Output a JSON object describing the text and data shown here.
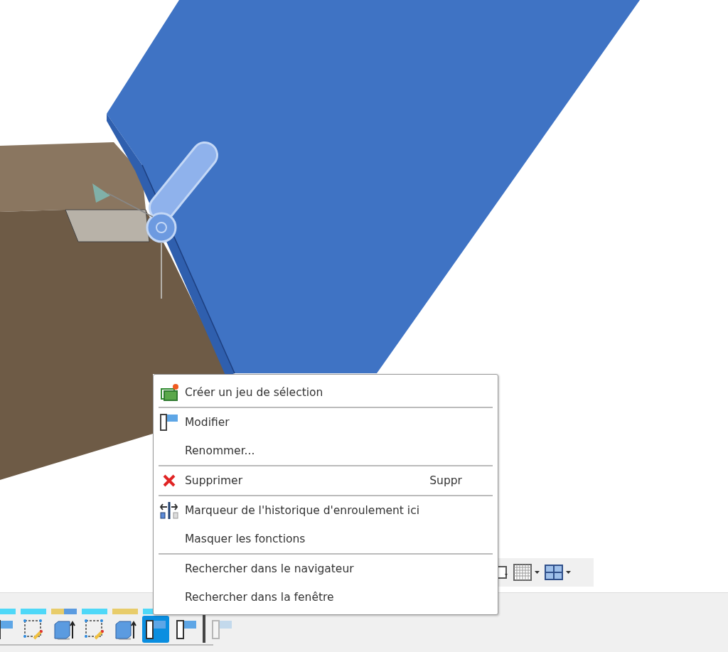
{
  "context_menu": {
    "items": [
      {
        "kind": "create",
        "label": "Créer un jeu de sélection"
      },
      {
        "kind": "separator"
      },
      {
        "kind": "edit",
        "label": "Modifier"
      },
      {
        "kind": "plain",
        "label": "Renommer..."
      },
      {
        "kind": "separator"
      },
      {
        "kind": "delete",
        "label": "Supprimer",
        "shortcut": "Suppr"
      },
      {
        "kind": "separator"
      },
      {
        "kind": "rollback",
        "label": "Marqueur de l'historique d'enroulement ici"
      },
      {
        "kind": "plain",
        "label": "Masquer les fonctions"
      },
      {
        "kind": "separator"
      },
      {
        "kind": "plain",
        "label": "Rechercher dans le navigateur"
      },
      {
        "kind": "plain",
        "label": "Rechercher dans la fenêtre"
      }
    ]
  },
  "timeline": {
    "items": [
      {
        "kind": "joint",
        "selected": false,
        "rolled_back": false,
        "color": "#4fd8f8"
      },
      {
        "kind": "sketch",
        "selected": false,
        "rolled_back": false,
        "color": "#4fd8f8"
      },
      {
        "kind": "extrude",
        "selected": false,
        "rolled_back": false,
        "color": "#e8cc6a",
        "second_tag": {
          "color": "#5b9be0"
        }
      },
      {
        "kind": "sketch",
        "selected": false,
        "rolled_back": false,
        "color": "#4fd8f8"
      },
      {
        "kind": "extrude",
        "selected": false,
        "rolled_back": false,
        "color": "#e8cc6a"
      },
      {
        "kind": "joint",
        "selected": true,
        "rolled_back": false,
        "color": "#4fd8f8"
      },
      {
        "kind": "joint",
        "selected": false,
        "rolled_back": false
      },
      {
        "kind": "marker"
      },
      {
        "kind": "joint",
        "selected": false,
        "rolled_back": true
      }
    ]
  }
}
